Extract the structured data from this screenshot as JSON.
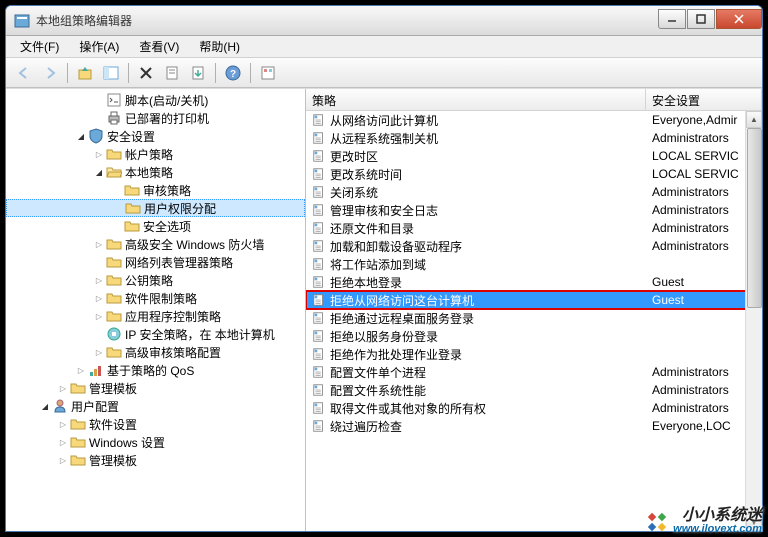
{
  "window": {
    "title": "本地组策略编辑器"
  },
  "menu": [
    "文件(F)",
    "操作(A)",
    "查看(V)",
    "帮助(H)"
  ],
  "tree": [
    {
      "indent": 3,
      "exp": " ",
      "icon": "script",
      "label": "脚本(启动/关机)"
    },
    {
      "indent": 3,
      "exp": " ",
      "icon": "printer",
      "label": "已部署的打印机"
    },
    {
      "indent": 2,
      "exp": "▾",
      "icon": "security",
      "label": "安全设置"
    },
    {
      "indent": 3,
      "exp": "▸",
      "icon": "folder-c",
      "label": "帐户策略"
    },
    {
      "indent": 3,
      "exp": "▾",
      "icon": "folder-o",
      "label": "本地策略"
    },
    {
      "indent": 4,
      "exp": " ",
      "icon": "folder-c",
      "label": "审核策略"
    },
    {
      "indent": 4,
      "exp": " ",
      "icon": "folder-c",
      "label": "用户权限分配",
      "selected": true
    },
    {
      "indent": 4,
      "exp": " ",
      "icon": "folder-c",
      "label": "安全选项"
    },
    {
      "indent": 3,
      "exp": "▸",
      "icon": "folder-c",
      "label": "高级安全 Windows 防火墙"
    },
    {
      "indent": 3,
      "exp": " ",
      "icon": "folder-c",
      "label": "网络列表管理器策略"
    },
    {
      "indent": 3,
      "exp": "▸",
      "icon": "folder-c",
      "label": "公钥策略"
    },
    {
      "indent": 3,
      "exp": "▸",
      "icon": "folder-c",
      "label": "软件限制策略"
    },
    {
      "indent": 3,
      "exp": "▸",
      "icon": "folder-c",
      "label": "应用程序控制策略"
    },
    {
      "indent": 3,
      "exp": " ",
      "icon": "ipsec",
      "label": "IP 安全策略，在 本地计算机"
    },
    {
      "indent": 3,
      "exp": "▸",
      "icon": "folder-c",
      "label": "高级审核策略配置"
    },
    {
      "indent": 2,
      "exp": "▸",
      "icon": "qos",
      "label": "基于策略的 QoS"
    },
    {
      "indent": 1,
      "exp": "▸",
      "icon": "folder-c",
      "label": "管理模板"
    },
    {
      "indent": 0,
      "exp": "▾",
      "icon": "user",
      "label": "用户配置"
    },
    {
      "indent": 1,
      "exp": "▸",
      "icon": "folder-c",
      "label": "软件设置"
    },
    {
      "indent": 1,
      "exp": "▸",
      "icon": "folder-c",
      "label": "Windows 设置"
    },
    {
      "indent": 1,
      "exp": "▸",
      "icon": "folder-c",
      "label": "管理模板"
    }
  ],
  "list": {
    "headers": [
      "策略",
      "安全设置"
    ],
    "rows": [
      {
        "policy": "从网络访问此计算机",
        "value": "Everyone,Admir"
      },
      {
        "policy": "从远程系统强制关机",
        "value": "Administrators"
      },
      {
        "policy": "更改时区",
        "value": "LOCAL SERVIC"
      },
      {
        "policy": "更改系统时间",
        "value": "LOCAL SERVIC"
      },
      {
        "policy": "关闭系统",
        "value": "Administrators"
      },
      {
        "policy": "管理审核和安全日志",
        "value": "Administrators"
      },
      {
        "policy": "还原文件和目录",
        "value": "Administrators"
      },
      {
        "policy": "加载和卸载设备驱动程序",
        "value": "Administrators"
      },
      {
        "policy": "将工作站添加到域",
        "value": ""
      },
      {
        "policy": "拒绝本地登录",
        "value": "Guest"
      },
      {
        "policy": "拒绝从网络访问这台计算机",
        "value": "Guest",
        "selected": true,
        "highlight": true
      },
      {
        "policy": "拒绝通过远程桌面服务登录",
        "value": ""
      },
      {
        "policy": "拒绝以服务身份登录",
        "value": ""
      },
      {
        "policy": "拒绝作为批处理作业登录",
        "value": ""
      },
      {
        "policy": "配置文件单个进程",
        "value": "Administrators"
      },
      {
        "policy": "配置文件系统性能",
        "value": "Administrators"
      },
      {
        "policy": "取得文件或其他对象的所有权",
        "value": "Administrators"
      },
      {
        "policy": "绕过遍历检查",
        "value": "Everyone,LOC"
      }
    ]
  },
  "watermark": {
    "cn": "小小系统迷",
    "url": "www.ilovext.com"
  }
}
